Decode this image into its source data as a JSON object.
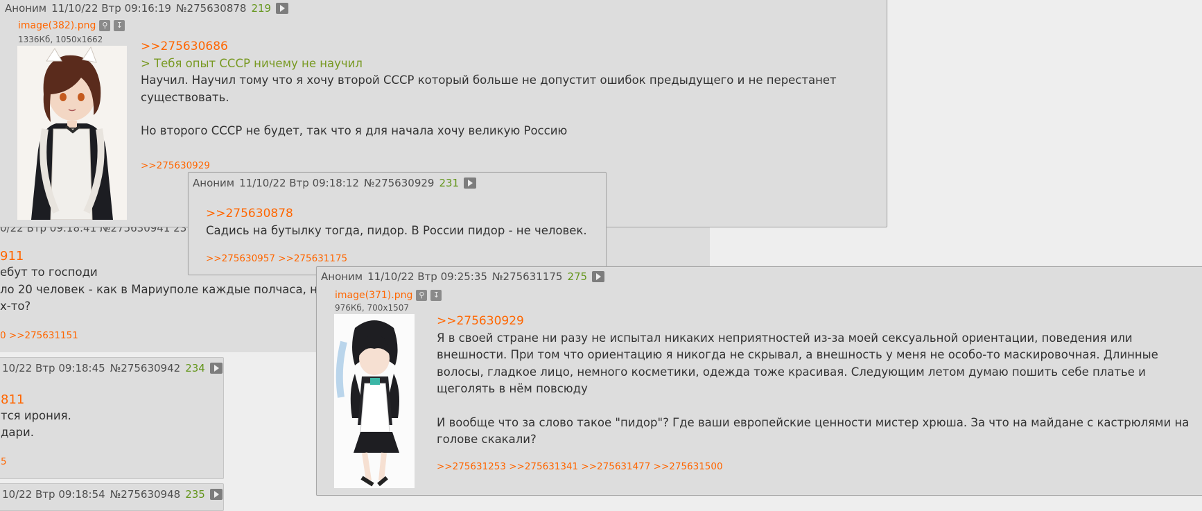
{
  "bg": {
    "p1_head": "0/22 Втр 09:18:41 №275630941 23",
    "p1_reply": "911",
    "p1_line1": "ебут то господи",
    "p1_line2": "ло 20 человек - как в Мариуполе каждые полчаса, н",
    "p1_line3": "х-то?",
    "p1_links": "0 >>275631151",
    "p2_head_date": "10/22 Втр 09:18:45",
    "p2_head_num": "№275630942",
    "p2_head_replies": "234",
    "p2_reply": "811",
    "p2_line1": "тся ирония.",
    "p2_line2": "дари.",
    "p2_links": "5",
    "p3_head_date": "10/22 Втр 09:18:54",
    "p3_head_num": "№275630948",
    "p3_head_replies": "235"
  },
  "post_a": {
    "name": "Аноним",
    "date": "11/10/22 Втр 09:16:19",
    "num": "№275630878",
    "replies": "219",
    "file_name": "image(382).png",
    "file_meta": "1336Кб, 1050x1662",
    "reply_to": ">>275630686",
    "quote": "> Тебя опыт СССР ничему не научил",
    "text1": "Научил. Научил тому что я хочу второй СССР который больше не допустит ошибок предыдущего и не перестанет существовать.",
    "text2": "Но второго СССР не будет, так что я для начала хочу великую Россию",
    "backlinks": ">>275630929"
  },
  "post_b": {
    "name": "Аноним",
    "date": "11/10/22 Втр 09:18:12",
    "num": "№275630929",
    "replies": "231",
    "reply_to": ">>275630878",
    "text": "Садись на бутылку тогда, пидор. В России пидор - не человек.",
    "backlinks": ">>275630957 >>275631175"
  },
  "post_c": {
    "name": "Аноним",
    "date": "11/10/22 Втр 09:25:35",
    "num": "№275631175",
    "replies": "275",
    "file_name": "image(371).png",
    "file_meta": "976Кб, 700x1507",
    "reply_to": ">>275630929",
    "text1": "Я в своей стране ни разу не испытал никаких неприятностей из-за моей сексуальной ориентации, поведения или внешности. При том что ориентацию я никогда не скрывал, а внешность у меня не особо-то маскировочная. Длинные волосы, гладкое лицо, немного косметики, одежда тоже красивая. Следующим летом думаю пошить себе платье и щеголять в нём повсюду",
    "text2": "И вообще что за слово такое \"пидор\"? Где ваши европейские ценности мистер хрюша. За что на майдане с кастрюлями на голове скакали?",
    "backlinks": ">>275631253 >>275631341 >>275631477 >>275631500"
  },
  "icons": {
    "search": "magnifier-icon",
    "download": "download-icon",
    "play": "play-icon"
  }
}
